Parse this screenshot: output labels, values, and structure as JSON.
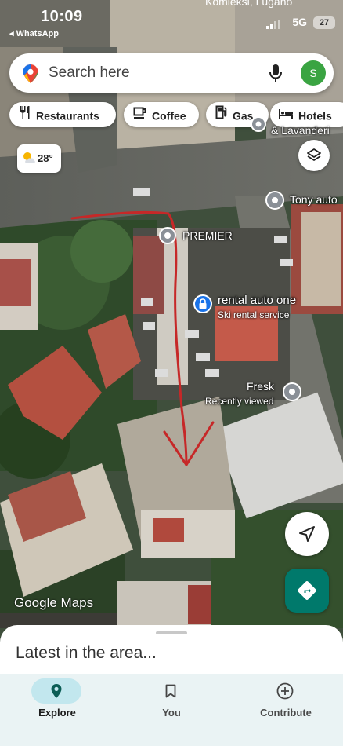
{
  "status_bar": {
    "time": "10:09",
    "back_app": "◂ WhatsApp",
    "network": "5G",
    "battery": "27",
    "place_top": "Komleksi, Lugano"
  },
  "search": {
    "placeholder": "Search here",
    "avatar_letter": "S"
  },
  "chips": [
    {
      "label": "Restaurants",
      "icon": "fork-knife-icon"
    },
    {
      "label": "Coffee",
      "icon": "coffee-cup-icon"
    },
    {
      "label": "Gas",
      "icon": "gas-pump-icon"
    },
    {
      "label": "Hotels",
      "icon": "bed-icon"
    }
  ],
  "weather": {
    "temp": "28°",
    "icon": "partly-sunny-icon"
  },
  "map_labels": {
    "lavanderia": "& Lavanderi",
    "tony": "Tony auto",
    "premier": "PREMIER",
    "rental_title": "rental auto one",
    "rental_sub": "Ski rental service",
    "fresk_title": "Fresk",
    "fresk_sub": "Recently viewed"
  },
  "attribution": "Google Maps",
  "sheet": {
    "title": "Latest in the area..."
  },
  "nav": [
    {
      "label": "Explore",
      "icon": "map-pin-icon",
      "active": true
    },
    {
      "label": "You",
      "icon": "bookmark-icon",
      "active": false
    },
    {
      "label": "Contribute",
      "icon": "plus-circle-icon",
      "active": false
    }
  ],
  "colors": {
    "accent_teal": "#00796b",
    "arrow_red": "#c62828",
    "avatar_green": "#3aa442",
    "nav_bg": "#eaf3f4",
    "active_pill": "#c2e7ee"
  }
}
